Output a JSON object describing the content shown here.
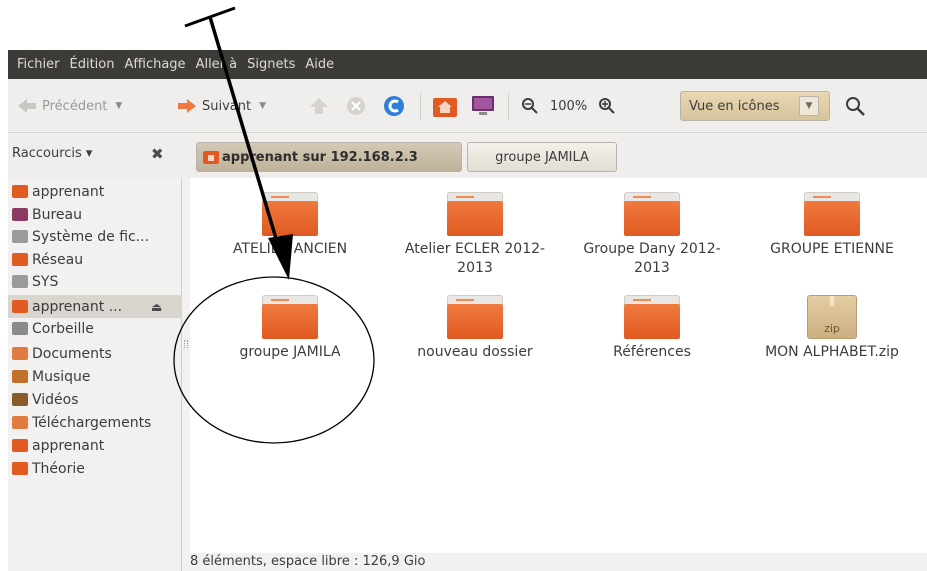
{
  "menubar": {
    "items": [
      "Fichier",
      "Édition",
      "Affichage",
      "Aller à",
      "Signets",
      "Aide"
    ]
  },
  "toolbar": {
    "back_label": "Précédent",
    "forward_label": "Suivant",
    "zoom_level": "100%",
    "view_mode": "Vue en icônes"
  },
  "sidebar": {
    "header": "Raccourcis ▾",
    "items": [
      {
        "label": "apprenant",
        "icon": "home-folder-icon",
        "color": "#e05a22"
      },
      {
        "label": "Bureau",
        "icon": "desktop-icon",
        "color": "#8b3a62"
      },
      {
        "label": "Système de fic...",
        "icon": "drive-icon",
        "color": "#9a9a9a"
      },
      {
        "label": "Réseau",
        "icon": "network-icon",
        "color": "#e05a22"
      },
      {
        "label": "SYS",
        "icon": "drive-icon",
        "color": "#9a9a9a"
      },
      {
        "label": "apprenant ...",
        "icon": "network-share-icon",
        "color": "#e05a22"
      },
      {
        "label": "Corbeille",
        "icon": "trash-icon",
        "color": "#8a8a8a"
      },
      {
        "label": "Documents",
        "icon": "documents-folder-icon",
        "color": "#e07a40"
      },
      {
        "label": "Musique",
        "icon": "music-folder-icon",
        "color": "#c0702a"
      },
      {
        "label": "Vidéos",
        "icon": "videos-folder-icon",
        "color": "#8a5a2a"
      },
      {
        "label": "Téléchargements",
        "icon": "downloads-folder-icon",
        "color": "#e07a40"
      },
      {
        "label": "apprenant",
        "icon": "network-share-icon",
        "color": "#e05a22"
      },
      {
        "label": "Théorie",
        "icon": "folder-icon",
        "color": "#e05a22"
      }
    ]
  },
  "location": {
    "crumbs": [
      "apprenant sur 192.168.2.3",
      "groupe JAMILA"
    ]
  },
  "files": [
    {
      "name": "ATELIER ANCIEN",
      "type": "folder"
    },
    {
      "name": "Atelier ECLER 2012-2013",
      "type": "folder"
    },
    {
      "name": "Groupe Dany 2012-2013",
      "type": "folder"
    },
    {
      "name": "GROUPE ETIENNE",
      "type": "folder"
    },
    {
      "name": "groupe JAMILA",
      "type": "folder"
    },
    {
      "name": "nouveau dossier",
      "type": "folder"
    },
    {
      "name": "Références",
      "type": "folder"
    },
    {
      "name": "MON ALPHABET.zip",
      "type": "zip",
      "badge": "zip"
    }
  ],
  "status": {
    "text": "8 éléments, espace libre : 126,9 Gio"
  },
  "colors": {
    "menubar": "#3c3b37",
    "accent_orange": "#e05a22",
    "annotation": "#000000"
  }
}
